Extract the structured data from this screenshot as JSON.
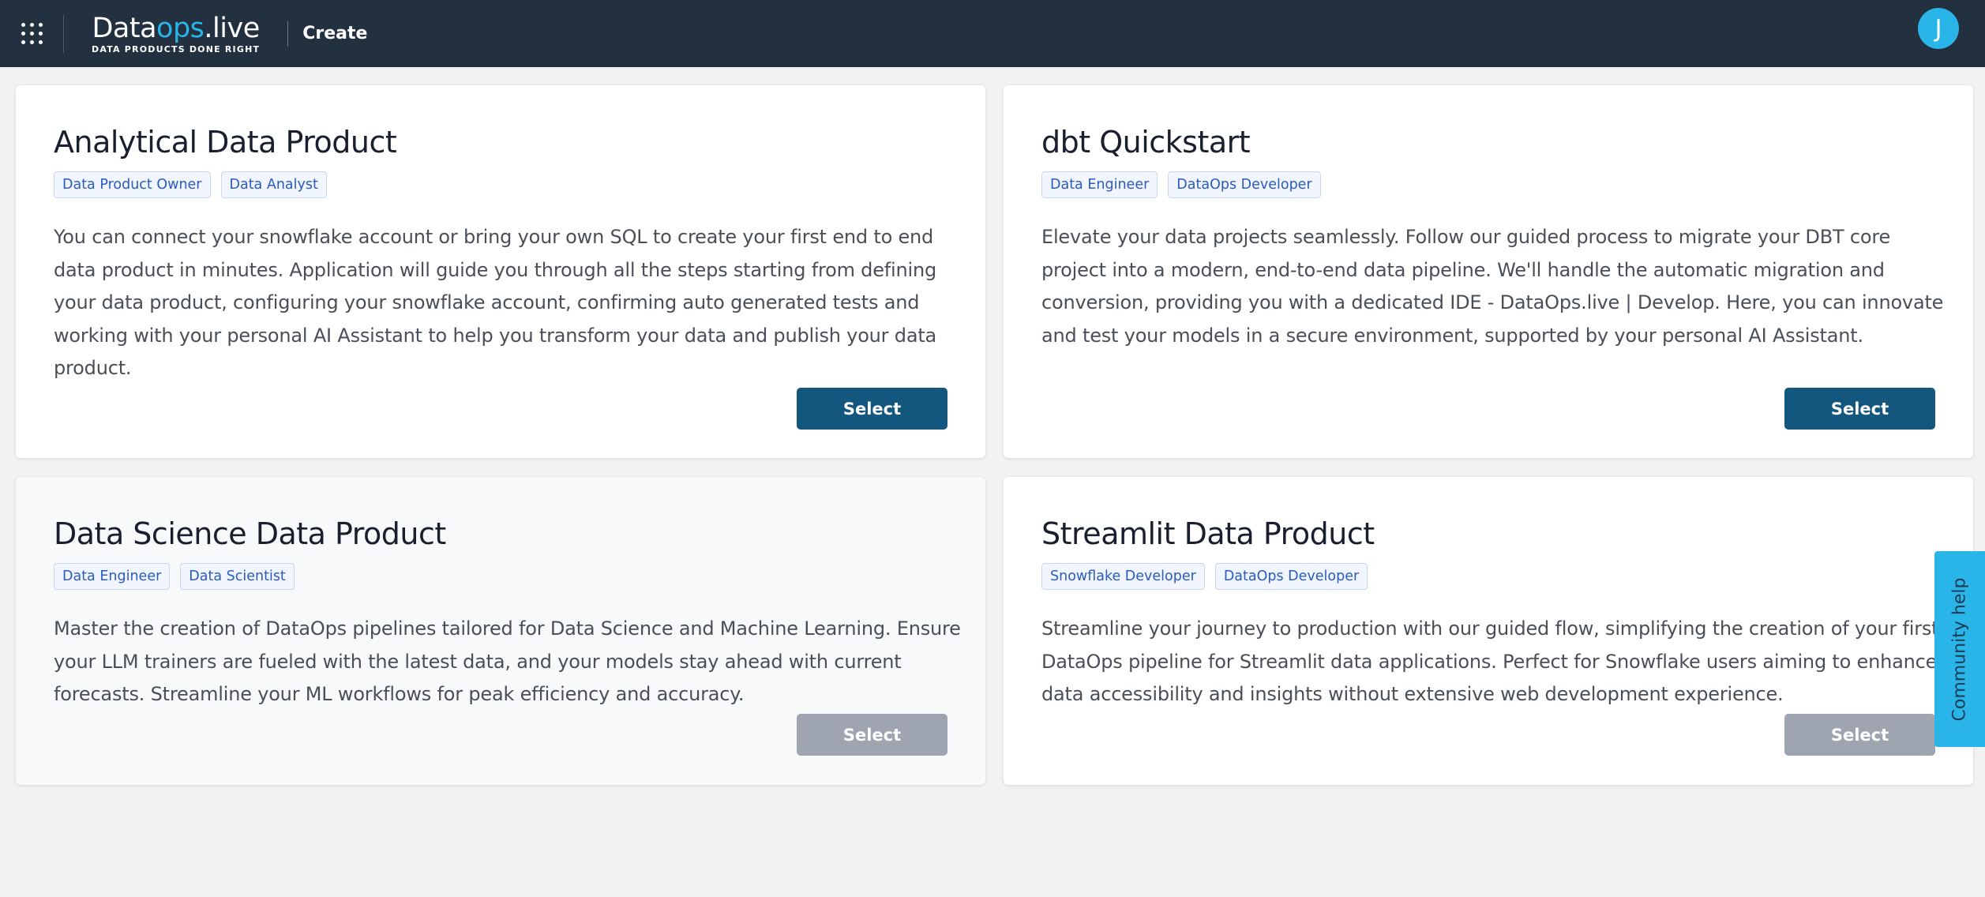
{
  "header": {
    "logo_prefix": "Data",
    "logo_accent": "ops",
    "logo_suffix": ".live",
    "logo_tagline": "DATA PRODUCTS DONE RIGHT",
    "page_title": "Create",
    "avatar_initial": "J"
  },
  "cards": [
    {
      "title": "Analytical Data Product",
      "tags": [
        "Data Product Owner",
        "Data Analyst"
      ],
      "description": "You can connect your snowflake account or bring your own SQL to create your first end to end data product in minutes. Application will guide you through all the steps starting from defining your data product, configuring your snowflake account, confirming auto generated tests and working with your personal AI Assistant to help you transform your data and publish your data product.",
      "button_label": "Select",
      "enabled": true
    },
    {
      "title": "dbt Quickstart",
      "tags": [
        "Data Engineer",
        "DataOps Developer"
      ],
      "description": "Elevate your data projects seamlessly. Follow our guided process to migrate your DBT core project into a modern, end-to-end data pipeline. We'll handle the automatic migration and conversion, providing you with a dedicated IDE - DataOps.live | Develop. Here, you can innovate and test your models in a secure environment, supported by your personal AI Assistant.",
      "button_label": "Select",
      "enabled": true
    },
    {
      "title": "Data Science Data Product",
      "tags": [
        "Data Engineer",
        "Data Scientist"
      ],
      "description": "Master the creation of DataOps pipelines tailored for Data Science and Machine Learning. Ensure your LLM trainers are fueled with the latest data, and your models stay ahead with current forecasts. Streamline your ML workflows for peak efficiency and accuracy.",
      "button_label": "Select",
      "enabled": false
    },
    {
      "title": "Streamlit Data Product",
      "tags": [
        "Snowflake Developer",
        "DataOps Developer"
      ],
      "description": "Streamline your journey to production with our guided flow, simplifying the creation of your first DataOps pipeline for Streamlit data applications. Perfect for Snowflake users aiming to enhance data accessibility and insights without extensive web development experience.",
      "button_label": "Select",
      "enabled": false
    }
  ],
  "community_help_label": "Community help",
  "colors": {
    "header_bg": "#22303f",
    "accent": "#29b5e8",
    "primary_button": "#14577e",
    "disabled_button": "#9ea5b0"
  }
}
